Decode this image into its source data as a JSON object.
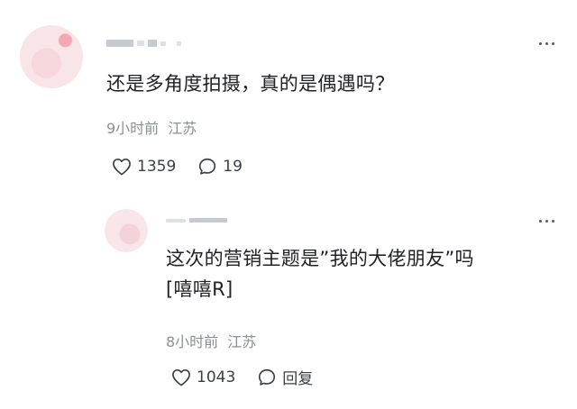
{
  "comments": [
    {
      "text": "还是多角度拍摄，真的是偶遇吗？",
      "time": "9小时前",
      "location": "江苏",
      "likes": "1359",
      "replies": "19",
      "like_icon": "heart-outline-icon",
      "reply_icon": "speech-bubble-icon"
    },
    {
      "text": "这次的营销主题是”我的大佬朋友”吗\n[嘻嘻R]",
      "time": "8小时前",
      "location": "江苏",
      "likes": "1043",
      "reply_label": "回复",
      "like_icon": "heart-outline-icon",
      "reply_icon": "speech-bubble-icon"
    }
  ],
  "colors": {
    "text": "#202227",
    "meta": "#8a8f96",
    "icon": "#3b3f45",
    "background": "#ffffff"
  }
}
